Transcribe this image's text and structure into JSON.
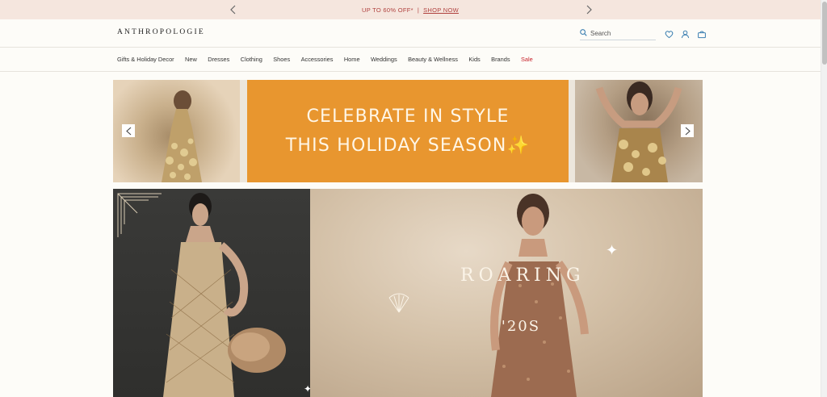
{
  "promo": {
    "text": "UP TO 60% OFF*",
    "separator": "|",
    "link": "SHOP NOW"
  },
  "header": {
    "logo": "ANTHROPOLOGIE",
    "search_placeholder": "Search",
    "icons": [
      "heart-icon",
      "user-icon",
      "bag-icon"
    ]
  },
  "nav": {
    "items": [
      "Gifts & Holiday Decor",
      "New",
      "Dresses",
      "Clothing",
      "Shoes",
      "Accessories",
      "Home",
      "Weddings",
      "Beauty & Wellness",
      "Kids",
      "Brands",
      "Sale"
    ]
  },
  "hero": {
    "line1": "CELEBRATE IN STYLE",
    "line2": "THIS HOLIDAY SEASON",
    "sparkle": "✨",
    "panel_color": "#e8962f"
  },
  "roaring": {
    "word": "ROARING",
    "year": "'20S"
  },
  "colors": {
    "promo_bg": "#f5e6de",
    "promo_text": "#b0413e",
    "sale": "#c8232c",
    "accent_icon": "#3c7fb1"
  }
}
